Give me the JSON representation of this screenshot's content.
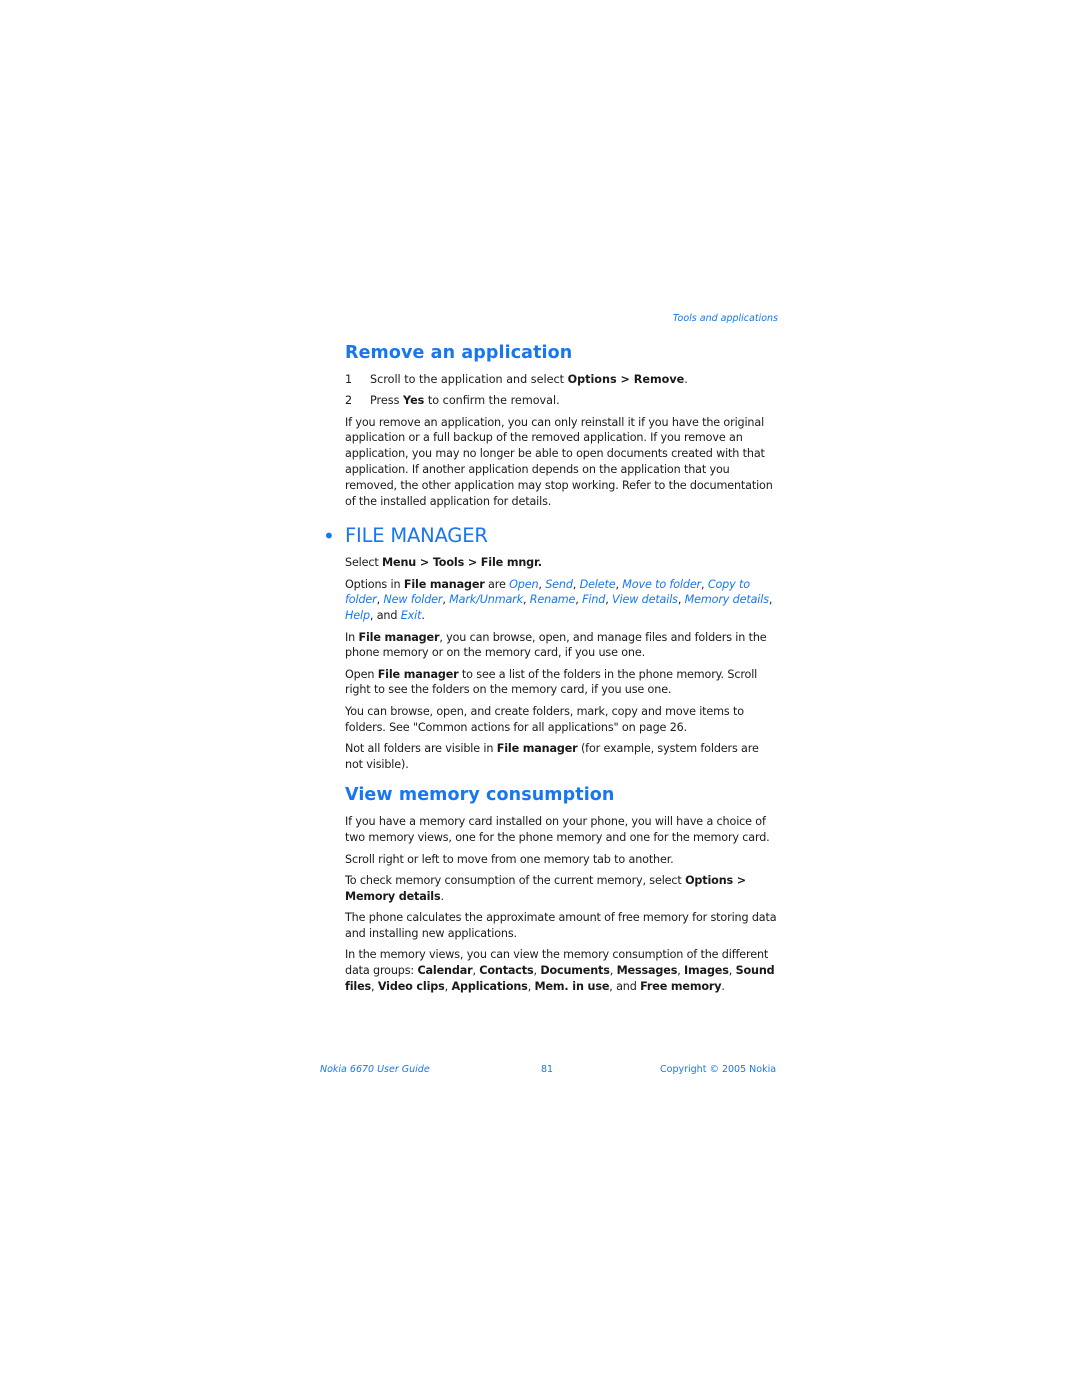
{
  "header": {
    "section_title": "Tools and applications"
  },
  "remove_app": {
    "title": "Remove an application",
    "steps": [
      {
        "num": "1",
        "pre": "Scroll to the application and select ",
        "b1": "Options",
        "mid": " > ",
        "b2": "Remove",
        "post": "."
      },
      {
        "num": "2",
        "pre": "Press ",
        "b1": "Yes",
        "post": " to confirm the removal."
      }
    ],
    "paragraph": "If you remove an application, you can only reinstall it if you have the original application or a full backup of the removed application. If you remove an application, you may no longer be able to open documents created with that application. If another application depends on the application that you removed, the other application may stop working. Refer to the documentation of the installed application for details."
  },
  "file_manager": {
    "bullet": "•",
    "title": "FILE MANAGER",
    "select_line": {
      "pre": "Select ",
      "path": [
        "Menu",
        "Tools",
        "File mngr."
      ],
      "sep": " > "
    },
    "options_line": {
      "pre": "Options in ",
      "app": "File manager",
      "mid": " are ",
      "options": [
        "Open",
        "Send",
        "Delete",
        "Move to folder",
        "Copy to folder",
        "New folder",
        "Mark/Unmark",
        "Rename",
        "Find",
        "View details",
        "Memory details",
        "Help"
      ],
      "and": ", and ",
      "last": "Exit",
      "end": "."
    },
    "p1": {
      "pre": "In ",
      "b": "File manager",
      "post": ", you can browse, open, and manage files and folders in the phone memory or on the memory card, if you use one."
    },
    "p2": {
      "pre": "Open ",
      "b": "File manager",
      "post": " to see a list of the folders in the phone memory. Scroll right to see the folders on the memory card, if you use one."
    },
    "p3": "You can browse, open, and create folders, mark, copy and move items to folders. See \"Common actions for all applications\" on page 26.",
    "p4": {
      "pre": "Not all folders are visible in ",
      "b": "File manager",
      "post": " (for example, system folders are not visible)."
    }
  },
  "view_memory": {
    "title": "View memory consumption",
    "p1": "If you have a memory card installed on your phone, you will have a choice of two memory views, one for the phone memory and one for the memory card.",
    "p2": "Scroll right or left to move from one memory tab to another.",
    "p3": {
      "pre": "To check memory consumption of the current memory, select ",
      "b1": "Options",
      "mid": " > ",
      "b2": "Memory details",
      "post": "."
    },
    "p4": "The phone calculates the approximate amount of free memory for storing data and installing new applications.",
    "p5": {
      "pre": "In the memory views, you can view the memory consumption of the different data groups: ",
      "groups": [
        "Calendar",
        "Contacts",
        "Documents",
        "Messages",
        "Images",
        "Sound files",
        "Video clips",
        "Applications",
        "Mem. in use"
      ],
      "and": ", and ",
      "last": "Free memory",
      "end": "."
    }
  },
  "footer": {
    "guide": "Nokia 6670 User Guide",
    "page": "81",
    "copyright": "Copyright © 2005 Nokia"
  }
}
